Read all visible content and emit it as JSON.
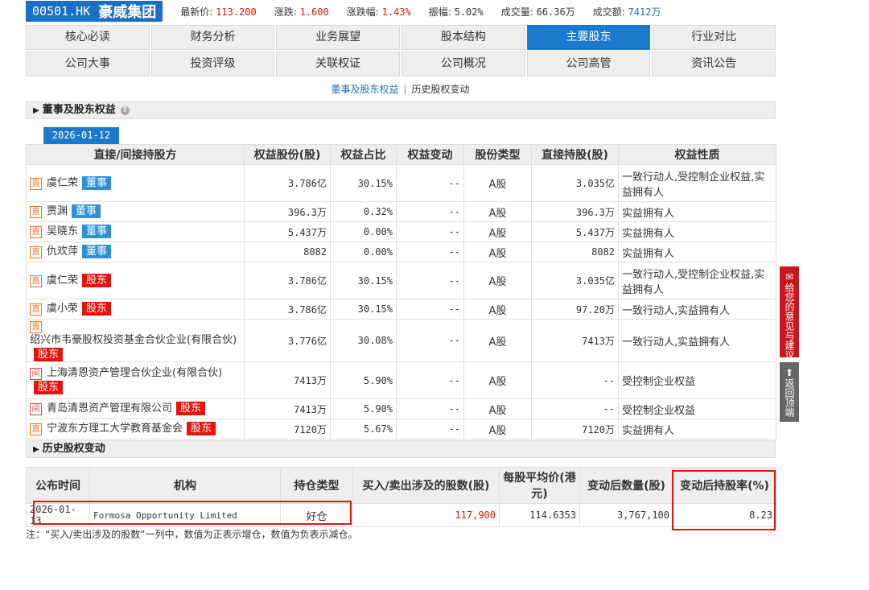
{
  "quote": {
    "code": "00501.HK",
    "name": "豪威集团",
    "items": [
      {
        "label": "最新价:",
        "value": "113.200",
        "color": "red"
      },
      {
        "label": "涨跌:",
        "value": "1.600",
        "color": "red"
      },
      {
        "label": "涨跌幅:",
        "value": "1.43%",
        "color": "red"
      },
      {
        "label": "振幅:",
        "value": "5.02%",
        "color": "plain"
      },
      {
        "label": "成交量:",
        "value": "66.36万",
        "color": "plain"
      },
      {
        "label": "成交额:",
        "value": "7412万",
        "color": "blue"
      }
    ]
  },
  "tabs": {
    "row1": [
      "核心必读",
      "财务分析",
      "业务展望",
      "股本结构",
      "主要股东",
      "行业对比"
    ],
    "row2": [
      "公司大事",
      "投资评级",
      "关联权证",
      "公司概况",
      "公司高管",
      "资讯公告"
    ],
    "active": "主要股东"
  },
  "subnav": {
    "active": "董事及股东权益",
    "other": "历史股权变动",
    "sep": "|"
  },
  "section1": {
    "title": "董事及股东权益",
    "help": "?"
  },
  "date_tab": "2026-01-12",
  "holders_table": {
    "headers": [
      "直接/间接持股方",
      "权益股份(股)",
      "权益占比",
      "权益变动",
      "股份类型",
      "直接持股(股)",
      "权益性质"
    ],
    "rows": [
      {
        "tag": "直",
        "name": "虞仁荣",
        "badge": "董事",
        "badge_type": "ds",
        "shares": "3.786亿",
        "pct": "30.15%",
        "change": "--",
        "type": "A股",
        "direct": "3.035亿",
        "nature": "一致行动人,受控制企业权益,实益拥有人"
      },
      {
        "tag": "直",
        "name": "贾渊",
        "badge": "董事",
        "badge_type": "ds",
        "shares": "396.3万",
        "pct": "0.32%",
        "change": "--",
        "type": "A股",
        "direct": "396.3万",
        "nature": "实益拥有人"
      },
      {
        "tag": "直",
        "name": "吴晓东",
        "badge": "董事",
        "badge_type": "ds",
        "shares": "5.437万",
        "pct": "0.00%",
        "change": "--",
        "type": "A股",
        "direct": "5.437万",
        "nature": "实益拥有人"
      },
      {
        "tag": "直",
        "name": "仇欢萍",
        "badge": "董事",
        "badge_type": "ds",
        "shares": "8082",
        "pct": "0.00%",
        "change": "--",
        "type": "A股",
        "direct": "8082",
        "nature": "实益拥有人"
      },
      {
        "tag": "直",
        "name": "虞仁荣",
        "badge": "股东",
        "badge_type": "gd",
        "shares": "3.786亿",
        "pct": "30.15%",
        "change": "--",
        "type": "A股",
        "direct": "3.035亿",
        "nature": "一致行动人,受控制企业权益,实益拥有人"
      },
      {
        "tag": "直",
        "name": "虞小荣",
        "badge": "股东",
        "badge_type": "gd",
        "shares": "3.786亿",
        "pct": "30.15%",
        "change": "--",
        "type": "A股",
        "direct": "97.20万",
        "nature": "一致行动人,实益拥有人"
      },
      {
        "tag": "直",
        "name": "绍兴市韦豪股权投资基金合伙企业(有限合伙)",
        "badge": "股东",
        "badge_type": "gd",
        "shares": "3.776亿",
        "pct": "30.08%",
        "change": "--",
        "type": "A股",
        "direct": "7413万",
        "nature": "一致行动人,实益拥有人"
      },
      {
        "tag": "间",
        "name": "上海清恩资产管理合伙企业(有限合伙)",
        "badge": "股东",
        "badge_type": "gd",
        "shares": "7413万",
        "pct": "5.90%",
        "change": "--",
        "type": "A股",
        "direct": "--",
        "nature": "受控制企业权益"
      },
      {
        "tag": "间",
        "name": "青岛清恩资产管理有限公司",
        "badge": "股东",
        "badge_type": "gd",
        "shares": "7413万",
        "pct": "5.90%",
        "change": "--",
        "type": "A股",
        "direct": "--",
        "nature": "受控制企业权益"
      },
      {
        "tag": "直",
        "name": "宁波东方理工大学教育基金会",
        "badge": "股东",
        "badge_type": "gd",
        "shares": "7120万",
        "pct": "5.67%",
        "change": "--",
        "type": "A股",
        "direct": "7120万",
        "nature": "实益拥有人"
      }
    ]
  },
  "section2": {
    "title": "历史股权变动"
  },
  "history_table": {
    "headers": [
      "公布时间",
      "机构",
      "持仓类型",
      "买入/卖出涉及的股数(股)",
      "每股平均价(港元)",
      "变动后数量(股)",
      "变动后持股率(%)"
    ],
    "rows": [
      {
        "date": "2026-01-13",
        "org": "Formosa Opportunity Limited",
        "position": "好仓",
        "shares": "117,900",
        "avg_price": "114.6353",
        "after_qty": "3,767,100",
        "after_pct": "8.23"
      }
    ]
  },
  "note": "注：“买入/卖出涉及的股数”一列中，数值为正表示增仓，数值为负表示减仓。",
  "side": {
    "feedback": "给您的意见与建议",
    "top": "返回顶端"
  }
}
